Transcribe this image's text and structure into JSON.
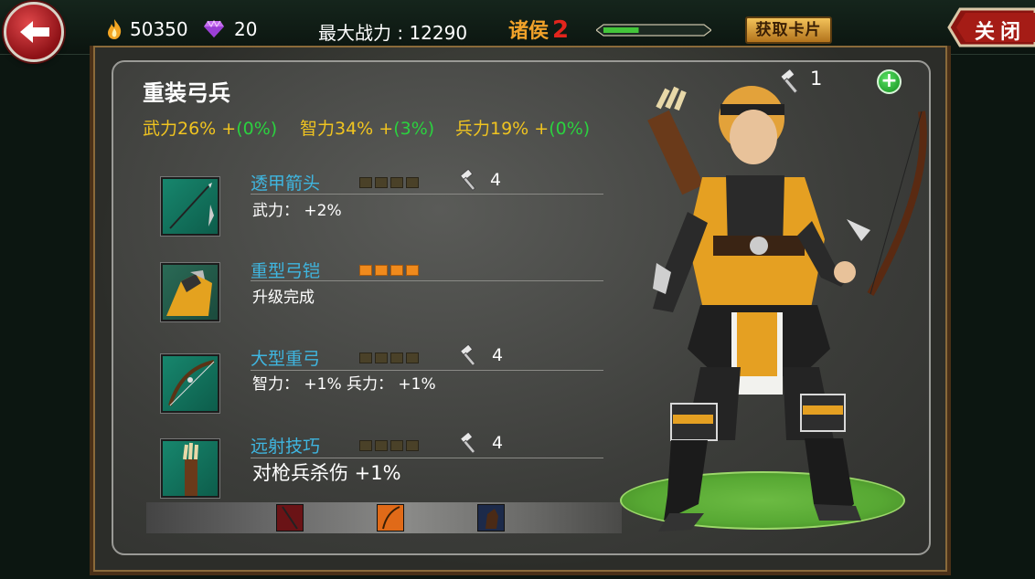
{
  "topbar": {
    "gold": "50350",
    "gems": "20",
    "max_power": "最大战力 : 12290",
    "rank_title": "诸侯",
    "rank_level": "2",
    "rank_progress": 0.35,
    "get_card_label": "获取卡片",
    "close_label": "关闭"
  },
  "unit": {
    "name": "重装弓兵",
    "hero_level": "1",
    "stats": [
      {
        "label": "武力26%",
        "plus": " +",
        "bonus": "(0%)"
      },
      {
        "label": "智力34%",
        "plus": " +",
        "bonus": "(3%)"
      },
      {
        "label": "兵力19%",
        "plus": " +",
        "bonus": "(0%)"
      }
    ]
  },
  "equipment": [
    {
      "name": "透甲箭头",
      "level": 0,
      "count": "4",
      "desc": "武力： +2%"
    },
    {
      "name": "重型弓铠",
      "level": 4,
      "count": "",
      "desc": "升级完成"
    },
    {
      "name": "大型重弓",
      "level": 0,
      "count": "4",
      "desc": "智力： +1%   兵力： +1%"
    },
    {
      "name": "远射技巧",
      "level": 0,
      "count": "4",
      "desc": "对枪兵杀伤 +1%"
    }
  ],
  "colors": {
    "stat_yellow": "#f0c420",
    "bonus_green": "#2bd23f",
    "equip_name_blue": "#3fb6e0",
    "pip_active": "#f08a1c",
    "rank_orange": "#f1a22a",
    "rank_red": "#e3251d"
  }
}
